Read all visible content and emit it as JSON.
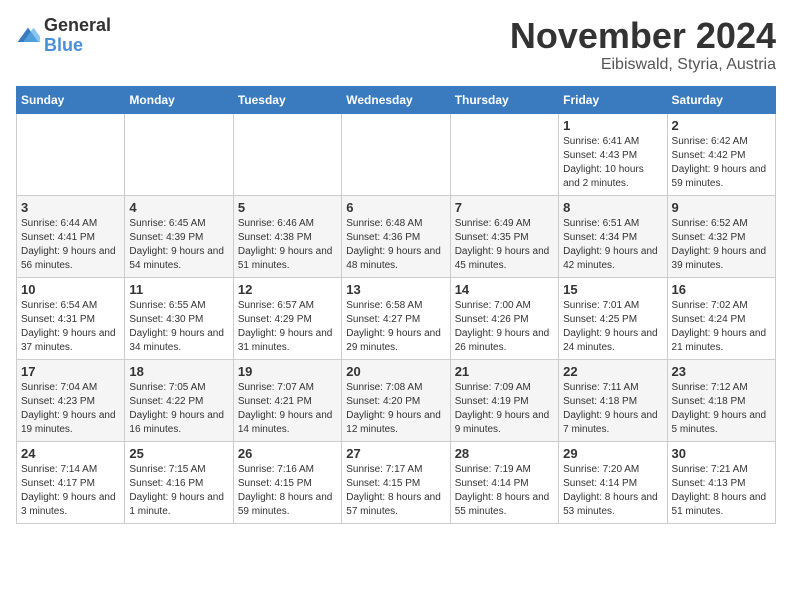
{
  "logo": {
    "general": "General",
    "blue": "Blue"
  },
  "title": {
    "month": "November 2024",
    "location": "Eibiswald, Styria, Austria"
  },
  "headers": [
    "Sunday",
    "Monday",
    "Tuesday",
    "Wednesday",
    "Thursday",
    "Friday",
    "Saturday"
  ],
  "weeks": [
    [
      {
        "day": "",
        "info": ""
      },
      {
        "day": "",
        "info": ""
      },
      {
        "day": "",
        "info": ""
      },
      {
        "day": "",
        "info": ""
      },
      {
        "day": "",
        "info": ""
      },
      {
        "day": "1",
        "info": "Sunrise: 6:41 AM\nSunset: 4:43 PM\nDaylight: 10 hours and 2 minutes."
      },
      {
        "day": "2",
        "info": "Sunrise: 6:42 AM\nSunset: 4:42 PM\nDaylight: 9 hours and 59 minutes."
      }
    ],
    [
      {
        "day": "3",
        "info": "Sunrise: 6:44 AM\nSunset: 4:41 PM\nDaylight: 9 hours and 56 minutes."
      },
      {
        "day": "4",
        "info": "Sunrise: 6:45 AM\nSunset: 4:39 PM\nDaylight: 9 hours and 54 minutes."
      },
      {
        "day": "5",
        "info": "Sunrise: 6:46 AM\nSunset: 4:38 PM\nDaylight: 9 hours and 51 minutes."
      },
      {
        "day": "6",
        "info": "Sunrise: 6:48 AM\nSunset: 4:36 PM\nDaylight: 9 hours and 48 minutes."
      },
      {
        "day": "7",
        "info": "Sunrise: 6:49 AM\nSunset: 4:35 PM\nDaylight: 9 hours and 45 minutes."
      },
      {
        "day": "8",
        "info": "Sunrise: 6:51 AM\nSunset: 4:34 PM\nDaylight: 9 hours and 42 minutes."
      },
      {
        "day": "9",
        "info": "Sunrise: 6:52 AM\nSunset: 4:32 PM\nDaylight: 9 hours and 39 minutes."
      }
    ],
    [
      {
        "day": "10",
        "info": "Sunrise: 6:54 AM\nSunset: 4:31 PM\nDaylight: 9 hours and 37 minutes."
      },
      {
        "day": "11",
        "info": "Sunrise: 6:55 AM\nSunset: 4:30 PM\nDaylight: 9 hours and 34 minutes."
      },
      {
        "day": "12",
        "info": "Sunrise: 6:57 AM\nSunset: 4:29 PM\nDaylight: 9 hours and 31 minutes."
      },
      {
        "day": "13",
        "info": "Sunrise: 6:58 AM\nSunset: 4:27 PM\nDaylight: 9 hours and 29 minutes."
      },
      {
        "day": "14",
        "info": "Sunrise: 7:00 AM\nSunset: 4:26 PM\nDaylight: 9 hours and 26 minutes."
      },
      {
        "day": "15",
        "info": "Sunrise: 7:01 AM\nSunset: 4:25 PM\nDaylight: 9 hours and 24 minutes."
      },
      {
        "day": "16",
        "info": "Sunrise: 7:02 AM\nSunset: 4:24 PM\nDaylight: 9 hours and 21 minutes."
      }
    ],
    [
      {
        "day": "17",
        "info": "Sunrise: 7:04 AM\nSunset: 4:23 PM\nDaylight: 9 hours and 19 minutes."
      },
      {
        "day": "18",
        "info": "Sunrise: 7:05 AM\nSunset: 4:22 PM\nDaylight: 9 hours and 16 minutes."
      },
      {
        "day": "19",
        "info": "Sunrise: 7:07 AM\nSunset: 4:21 PM\nDaylight: 9 hours and 14 minutes."
      },
      {
        "day": "20",
        "info": "Sunrise: 7:08 AM\nSunset: 4:20 PM\nDaylight: 9 hours and 12 minutes."
      },
      {
        "day": "21",
        "info": "Sunrise: 7:09 AM\nSunset: 4:19 PM\nDaylight: 9 hours and 9 minutes."
      },
      {
        "day": "22",
        "info": "Sunrise: 7:11 AM\nSunset: 4:18 PM\nDaylight: 9 hours and 7 minutes."
      },
      {
        "day": "23",
        "info": "Sunrise: 7:12 AM\nSunset: 4:18 PM\nDaylight: 9 hours and 5 minutes."
      }
    ],
    [
      {
        "day": "24",
        "info": "Sunrise: 7:14 AM\nSunset: 4:17 PM\nDaylight: 9 hours and 3 minutes."
      },
      {
        "day": "25",
        "info": "Sunrise: 7:15 AM\nSunset: 4:16 PM\nDaylight: 9 hours and 1 minute."
      },
      {
        "day": "26",
        "info": "Sunrise: 7:16 AM\nSunset: 4:15 PM\nDaylight: 8 hours and 59 minutes."
      },
      {
        "day": "27",
        "info": "Sunrise: 7:17 AM\nSunset: 4:15 PM\nDaylight: 8 hours and 57 minutes."
      },
      {
        "day": "28",
        "info": "Sunrise: 7:19 AM\nSunset: 4:14 PM\nDaylight: 8 hours and 55 minutes."
      },
      {
        "day": "29",
        "info": "Sunrise: 7:20 AM\nSunset: 4:14 PM\nDaylight: 8 hours and 53 minutes."
      },
      {
        "day": "30",
        "info": "Sunrise: 7:21 AM\nSunset: 4:13 PM\nDaylight: 8 hours and 51 minutes."
      }
    ]
  ]
}
